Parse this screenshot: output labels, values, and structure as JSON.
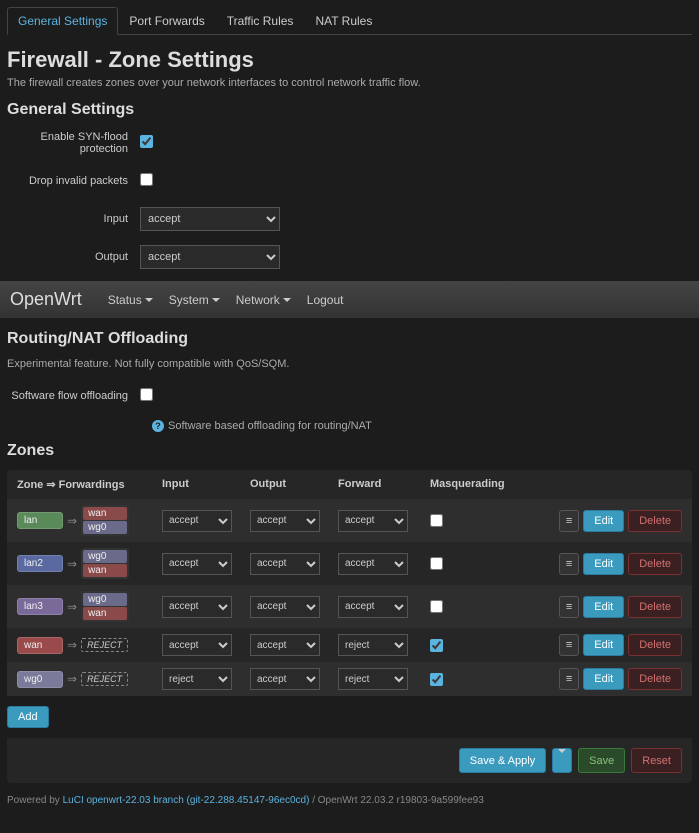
{
  "tabs": [
    "General Settings",
    "Port Forwards",
    "Traffic Rules",
    "NAT Rules"
  ],
  "title": "Firewall - Zone Settings",
  "subtitle": "The firewall creates zones over your network interfaces to control network traffic flow.",
  "section_general": "General Settings",
  "labels": {
    "syn": "Enable SYN-flood protection",
    "drop": "Drop invalid packets",
    "input": "Input",
    "output": "Output"
  },
  "general": {
    "input": "accept",
    "output": "accept"
  },
  "navbar": {
    "brand": "OpenWrt",
    "items": [
      "Status",
      "System",
      "Network"
    ],
    "logout": "Logout"
  },
  "offload": {
    "title": "Routing/NAT Offloading",
    "desc": "Experimental feature. Not fully compatible with QoS/SQM.",
    "label": "Software flow offloading",
    "help": "Software based offloading for routing/NAT"
  },
  "zones_title": "Zones",
  "zone_headers": {
    "zf": "Zone ⇒ Forwardings",
    "in": "Input",
    "out": "Output",
    "fwd": "Forward",
    "masq": "Masquerading"
  },
  "zone_rows": [
    {
      "name": "lan",
      "color": "#5a8a5a",
      "fwd": [
        {
          "n": "wan",
          "c": "#8a4a4a"
        },
        {
          "n": "wg0",
          "c": "#6a6a8a"
        }
      ],
      "in": "accept",
      "out": "accept",
      "f": "accept",
      "masq": false
    },
    {
      "name": "lan2",
      "color": "#5a6aa0",
      "fwd": [
        {
          "n": "wg0",
          "c": "#6a6a8a"
        },
        {
          "n": "wan",
          "c": "#8a4a4a"
        }
      ],
      "in": "accept",
      "out": "accept",
      "f": "accept",
      "masq": false
    },
    {
      "name": "lan3",
      "color": "#7a6a9a",
      "fwd": [
        {
          "n": "wg0",
          "c": "#6a6a8a"
        },
        {
          "n": "wan",
          "c": "#8a4a4a"
        }
      ],
      "in": "accept",
      "out": "accept",
      "f": "accept",
      "masq": false
    },
    {
      "name": "wan",
      "color": "#9a4a4a",
      "fwd": [],
      "rej": "REJECT",
      "in": "accept",
      "out": "accept",
      "f": "reject",
      "masq": true
    },
    {
      "name": "wg0",
      "color": "#7a7a9a",
      "fwd": [],
      "rej": "REJECT",
      "in": "reject",
      "out": "accept",
      "f": "reject",
      "masq": true
    }
  ],
  "btn": {
    "edit": "Edit",
    "del": "Delete",
    "add": "Add",
    "save_apply": "Save & Apply",
    "save": "Save",
    "reset": "Reset"
  },
  "footer": {
    "powered": "Powered by ",
    "link": "LuCI openwrt-22.03 branch (git-22.288.45147-96ec0cd)",
    "ver": " / OpenWrt 22.03.2 r19803-9a599fee93"
  }
}
